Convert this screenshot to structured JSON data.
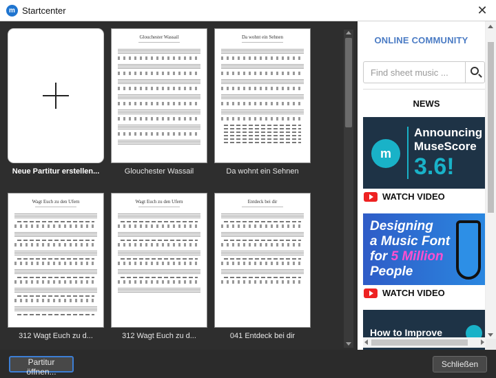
{
  "window": {
    "title": "Startcenter",
    "icon_letter": "m"
  },
  "scores": [
    {
      "label": "Neue Partitur erstellen...",
      "type": "new"
    },
    {
      "label": "Glouchester Wassail",
      "sheet_title": "Glouchester Wassail"
    },
    {
      "label": "Da wohnt ein Sehnen",
      "sheet_title": "Da wohnt ein Sehnen"
    },
    {
      "label": "312 Wagt Euch zu d...",
      "sheet_title": "Wagt Euch zu den Ufern"
    },
    {
      "label": "312 Wagt Euch zu d...",
      "sheet_title": "Wagt Euch zu den Ufern"
    },
    {
      "label": "041 Entdeck bei dir",
      "sheet_title": "Entdeck bei dir"
    }
  ],
  "panel": {
    "heading": "ONLINE COMMUNITY",
    "search_placeholder": "Find sheet music ...",
    "news_heading": "NEWS",
    "banner1": {
      "line1": "Announcing",
      "line2": "MuseScore",
      "version": "3.6!"
    },
    "banner2": {
      "line1": "Designing",
      "line2": "a Music Font",
      "line3_pre": "for ",
      "line3_hl": "5 Million",
      "line4": "People"
    },
    "banner3": {
      "text": "How to Improve"
    },
    "watch_label": "WATCH VIDEO"
  },
  "buttons": {
    "open": "Partitur öffnen...",
    "close": "Schließen"
  },
  "icons": {
    "app": "musescore-logo-icon",
    "close": "close-icon",
    "search": "search-icon",
    "youtube": "youtube-icon"
  },
  "colors": {
    "accent": "#4a7bc4",
    "musescore_teal": "#19b2c8",
    "youtube_red": "#ee2222",
    "focus_border": "#3d7fd6"
  }
}
